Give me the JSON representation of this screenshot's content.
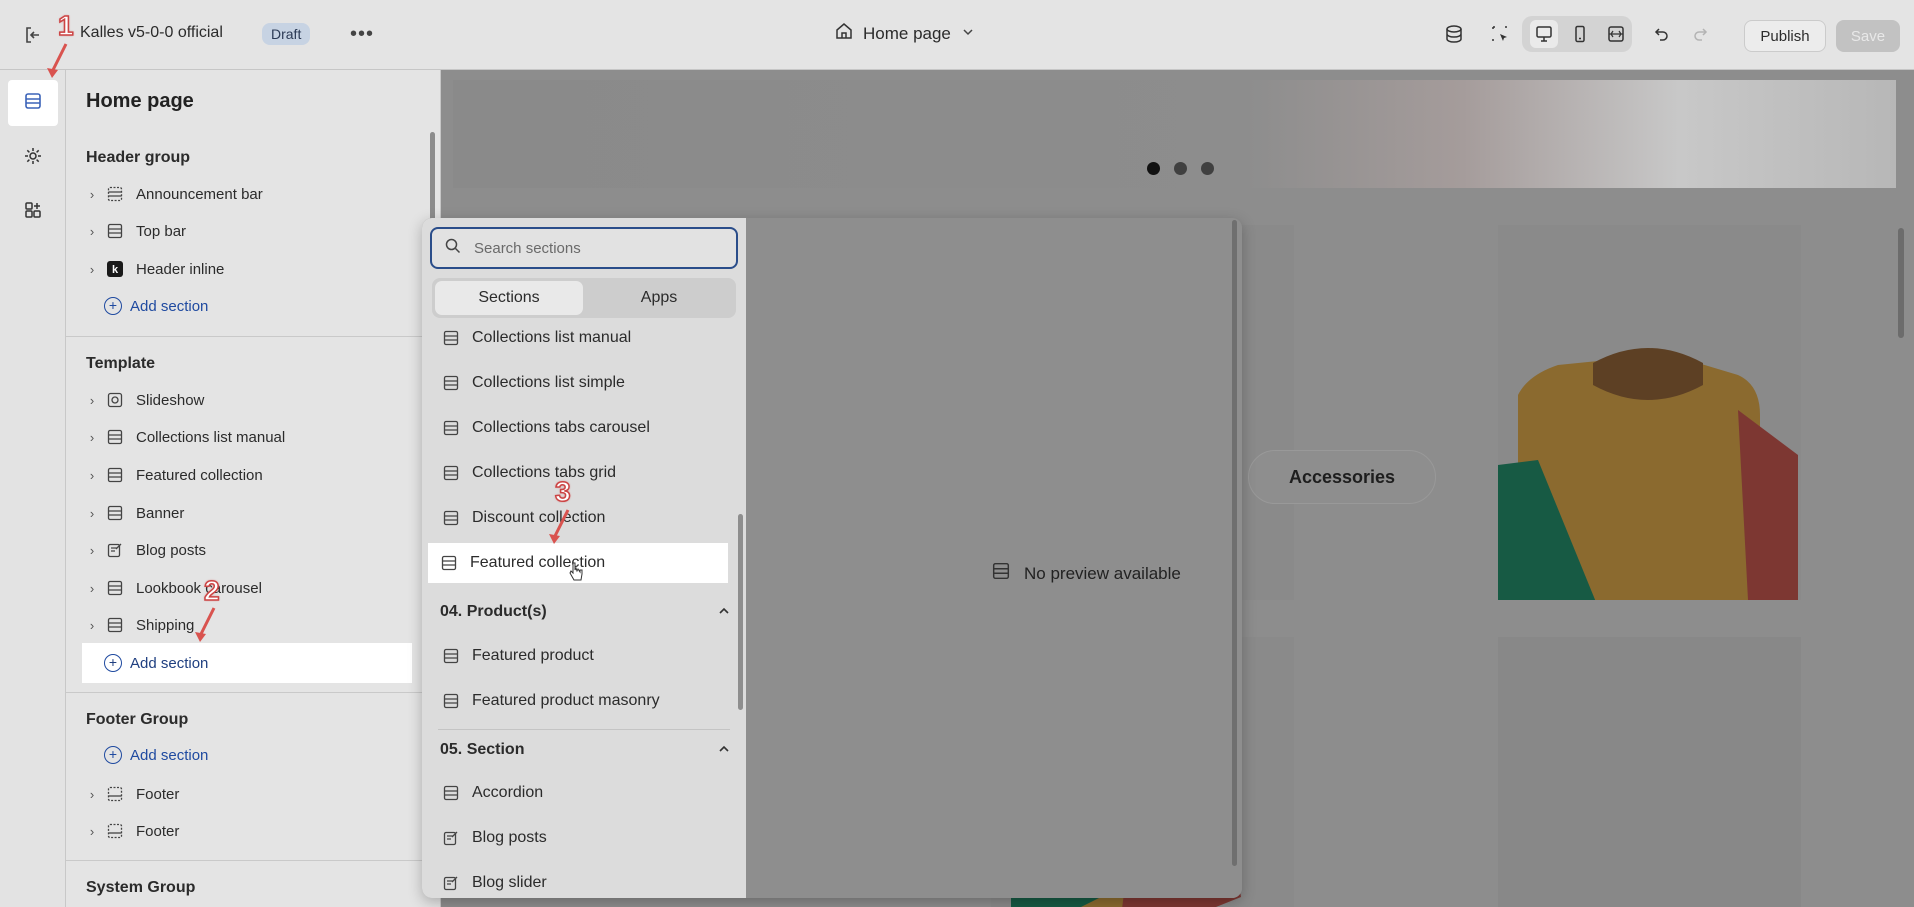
{
  "topbar": {
    "store_name": "Kalles v5-0-0 official",
    "status_badge": "Draft",
    "more_label": "•••",
    "page_selector": "Home page",
    "publish_label": "Publish",
    "save_label": "Save"
  },
  "panel": {
    "title": "Home page",
    "header_group": {
      "title": "Header group",
      "items": [
        {
          "label": "Announcement bar",
          "icon": "section-icon"
        },
        {
          "label": "Top bar",
          "icon": "section-icon"
        },
        {
          "label": "Header inline",
          "icon": "k-app-icon"
        }
      ],
      "add_label": "Add section"
    },
    "template": {
      "title": "Template",
      "items": [
        {
          "label": "Slideshow",
          "icon": "slideshow-icon"
        },
        {
          "label": "Collections list manual",
          "icon": "section-icon"
        },
        {
          "label": "Featured collection",
          "icon": "section-icon"
        },
        {
          "label": "Banner",
          "icon": "section-icon"
        },
        {
          "label": "Blog posts",
          "icon": "blog-icon"
        },
        {
          "label": "Lookbook carousel",
          "icon": "section-icon"
        },
        {
          "label": "Shipping",
          "icon": "section-icon"
        }
      ],
      "add_label": "Add section"
    },
    "footer_group": {
      "title": "Footer Group",
      "add_label": "Add section",
      "items": [
        {
          "label": "Footer",
          "icon": "footer-icon"
        },
        {
          "label": "Footer",
          "icon": "footer-icon"
        }
      ]
    },
    "system_group": {
      "title": "System Group"
    }
  },
  "popover": {
    "search_placeholder": "Search sections",
    "tabs": [
      "Sections",
      "Apps"
    ],
    "items_top": [
      "Collections list manual",
      "Collections list simple",
      "Collections tabs carousel",
      "Collections tabs grid",
      "Discount collection",
      "Featured collection"
    ],
    "category_products": "04. Product(s)",
    "items_products": [
      "Featured product",
      "Featured product masonry"
    ],
    "category_section": "05. Section",
    "items_section": [
      "Accordion",
      "Blog posts",
      "Blog slider"
    ],
    "no_preview": "No preview available"
  },
  "preview": {
    "pill_label": "Accessories"
  },
  "annotations": {
    "step1": "1",
    "step2": "2",
    "step3": "3"
  },
  "colors": {
    "accent_blue": "#1f4aa0",
    "annotation_red": "#cc4444",
    "selection_white": "#ffffff"
  }
}
